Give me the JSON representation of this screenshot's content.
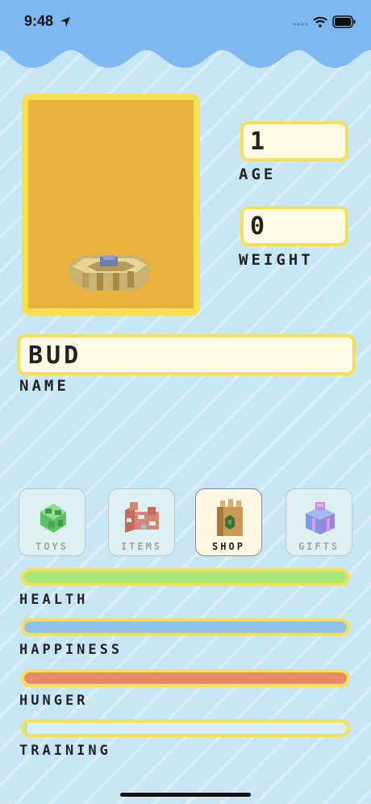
{
  "status_bar": {
    "time": "9:48",
    "icons": [
      "location-arrow-icon",
      "cellular-signal-icon",
      "wifi-icon",
      "battery-icon"
    ]
  },
  "colors": {
    "sky": "#7fb7f0",
    "background": "#c6e6f6",
    "frame_yellow": "#f7de52",
    "pet_canvas": "#e9b23c",
    "health": "#a8e87a",
    "happiness": "#8fc3ee",
    "hunger": "#e8896a",
    "training": "#b7e8a0"
  },
  "pet": {
    "image": "voxel-food-bowl-icon",
    "age": "1",
    "age_label": "AGE",
    "weight": "0",
    "weight_label": "WEIGHT",
    "name": "BUD",
    "name_label": "NAME"
  },
  "tabs": [
    {
      "label": "TOYS",
      "icon": "voxel-leaf-ball-icon",
      "active": false
    },
    {
      "label": "ITEMS",
      "icon": "voxel-brick-icon",
      "active": false
    },
    {
      "label": "SHOP",
      "icon": "voxel-shopping-bag-icon",
      "active": true
    },
    {
      "label": "GIFTS",
      "icon": "voxel-gift-box-icon",
      "active": false
    }
  ],
  "stats": {
    "health": {
      "label": "HEALTH",
      "value": 1.0
    },
    "happiness": {
      "label": "HAPPINESS",
      "value": 1.0
    },
    "hunger": {
      "label": "HUNGER",
      "value": 1.0
    },
    "training": {
      "label": "TRAINING",
      "value": 0.01
    }
  }
}
